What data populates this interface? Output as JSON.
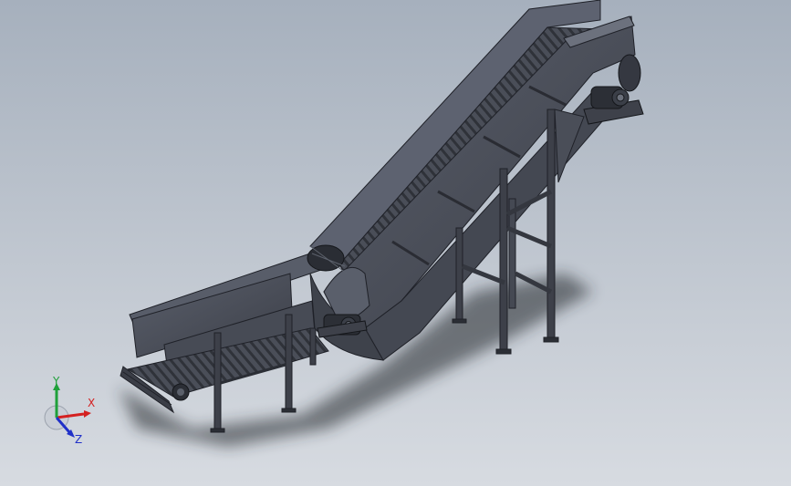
{
  "viewport": {
    "background_top": "#a6b0bd",
    "background_bottom": "#d7dbe1"
  },
  "model": {
    "body_color": "#4b4f5a",
    "body_dark": "#33363f",
    "body_light": "#6c717d",
    "edge_color": "#1f2128",
    "shadow_color": "#2a2d33"
  },
  "triad": {
    "x_label": "X",
    "y_label": "Y",
    "z_label": "Z",
    "x_color": "#d42020",
    "y_color": "#1fa03a",
    "z_color": "#2030c8"
  }
}
